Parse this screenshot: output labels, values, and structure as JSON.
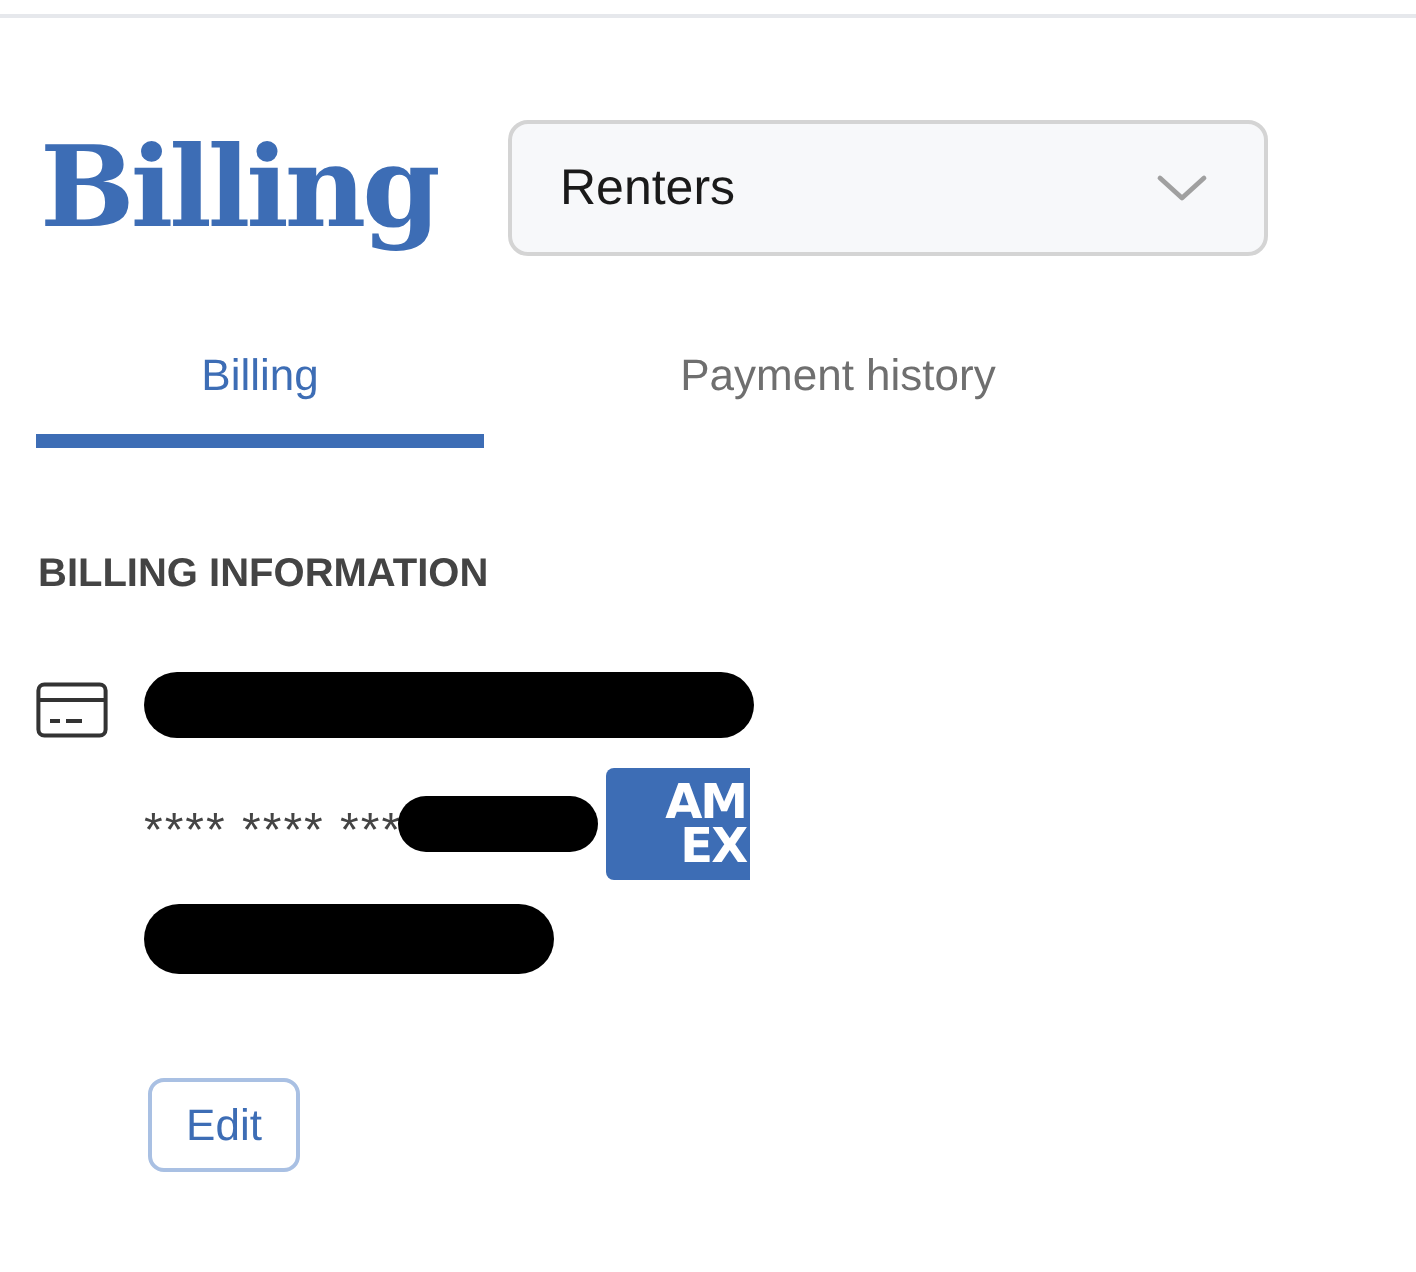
{
  "page": {
    "title": "Billing"
  },
  "account_select": {
    "value": "Renters"
  },
  "tabs": [
    {
      "label": "Billing",
      "selected": true
    },
    {
      "label": "Payment history",
      "selected": false
    }
  ],
  "billing_information": {
    "heading": "BILLING INFORMATION",
    "card_number": "**** **** ***",
    "card_logo": [
      "AM",
      "EX"
    ],
    "button": "Edit"
  }
}
